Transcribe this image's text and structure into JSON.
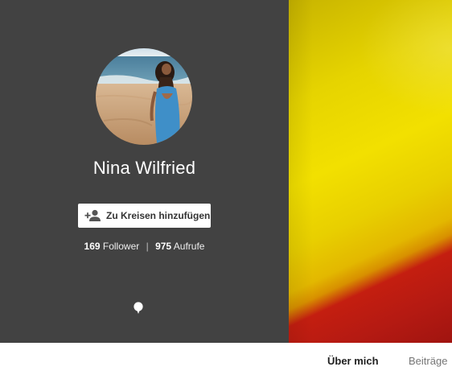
{
  "profile": {
    "name": "Nina Wilfried",
    "avatar_icon": "profile-photo",
    "add_button_label": "Zu Kreisen hinzufügen",
    "add_button_icon": "person-add-icon",
    "followers_count": "169",
    "followers_label": "Follower",
    "separator": "|",
    "views_count": "975",
    "views_label": "Aufrufe",
    "chat_icon": "speech-bubble-icon"
  },
  "tabs": [
    {
      "label": "Über mich",
      "active": true
    },
    {
      "label": "Beiträge",
      "active": false
    }
  ],
  "colors": {
    "panel_background": "#424242",
    "cover_yellow": "#f2e000",
    "cover_red": "#b51a12",
    "tab_active_text": "#212121",
    "tab_inactive_text": "#757575"
  }
}
